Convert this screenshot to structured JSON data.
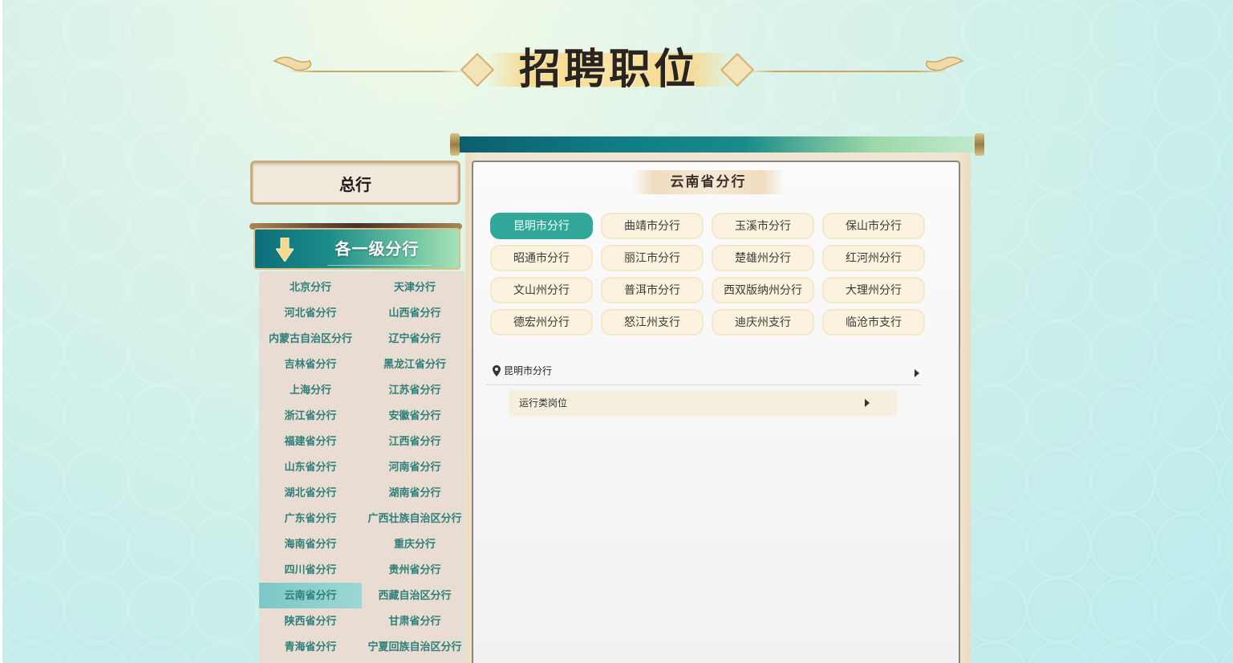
{
  "header": {
    "title": "招聘职位"
  },
  "left_nav": {
    "headquarters_label": "总行",
    "branches_header": "各一级分行",
    "branches": [
      {
        "label": "北京分行",
        "active": false
      },
      {
        "label": "天津分行",
        "active": false
      },
      {
        "label": "河北省分行",
        "active": false
      },
      {
        "label": "山西省分行",
        "active": false
      },
      {
        "label": "内蒙古自治区分行",
        "active": false
      },
      {
        "label": "辽宁省分行",
        "active": false
      },
      {
        "label": "吉林省分行",
        "active": false
      },
      {
        "label": "黑龙江省分行",
        "active": false
      },
      {
        "label": "上海分行",
        "active": false
      },
      {
        "label": "江苏省分行",
        "active": false
      },
      {
        "label": "浙江省分行",
        "active": false
      },
      {
        "label": "安徽省分行",
        "active": false
      },
      {
        "label": "福建省分行",
        "active": false
      },
      {
        "label": "江西省分行",
        "active": false
      },
      {
        "label": "山东省分行",
        "active": false
      },
      {
        "label": "河南省分行",
        "active": false
      },
      {
        "label": "湖北省分行",
        "active": false
      },
      {
        "label": "湖南省分行",
        "active": false
      },
      {
        "label": "广东省分行",
        "active": false
      },
      {
        "label": "广西壮族自治区分行",
        "active": false
      },
      {
        "label": "海南省分行",
        "active": false
      },
      {
        "label": "重庆分行",
        "active": false
      },
      {
        "label": "四川省分行",
        "active": false
      },
      {
        "label": "贵州省分行",
        "active": false
      },
      {
        "label": "云南省分行",
        "active": true
      },
      {
        "label": "西藏自治区分行",
        "active": false
      },
      {
        "label": "陕西省分行",
        "active": false
      },
      {
        "label": "甘肃省分行",
        "active": false
      },
      {
        "label": "青海省分行",
        "active": false
      },
      {
        "label": "宁夏回族自治区分行",
        "active": false
      }
    ]
  },
  "panel": {
    "province_title": "云南省分行",
    "cities": [
      {
        "label": "昆明市分行",
        "active": true
      },
      {
        "label": "曲靖市分行",
        "active": false
      },
      {
        "label": "玉溪市分行",
        "active": false
      },
      {
        "label": "保山市分行",
        "active": false
      },
      {
        "label": "昭通市分行",
        "active": false
      },
      {
        "label": "丽江市分行",
        "active": false
      },
      {
        "label": "楚雄州分行",
        "active": false
      },
      {
        "label": "红河州分行",
        "active": false
      },
      {
        "label": "文山州分行",
        "active": false
      },
      {
        "label": "普洱市分行",
        "active": false
      },
      {
        "label": "西双版纳州分行",
        "active": false
      },
      {
        "label": "大理州分行",
        "active": false
      },
      {
        "label": "德宏州分行",
        "active": false
      },
      {
        "label": "怒江州支行",
        "active": false
      },
      {
        "label": "迪庆州支行",
        "active": false
      },
      {
        "label": "临沧市支行",
        "active": false
      }
    ],
    "location": {
      "label": "昆明市分行",
      "icon": "map-pin-icon"
    },
    "job_category": {
      "label": "运行类岗位",
      "icon": "caret-right-icon"
    }
  },
  "colors": {
    "accent_teal": "#30a89a",
    "branch_text": "#2d7f7a",
    "gold": "#c8a868"
  }
}
